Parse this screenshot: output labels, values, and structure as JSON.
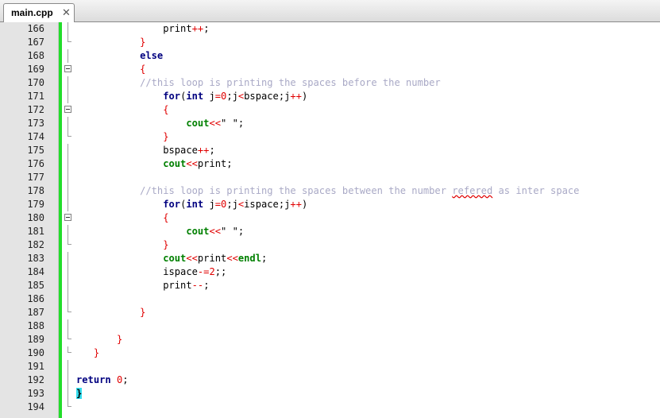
{
  "tab": {
    "title": "main.cpp",
    "close_glyph": "✕"
  },
  "lines": [
    {
      "n": "166",
      "fold": "line",
      "indent": 15,
      "tokens": [
        [
          "id",
          "print"
        ],
        [
          "op",
          "++"
        ],
        [
          "id",
          ";"
        ]
      ]
    },
    {
      "n": "167",
      "fold": "end",
      "indent": 11,
      "tokens": [
        [
          "brace",
          "}"
        ]
      ]
    },
    {
      "n": "168",
      "fold": "line",
      "indent": 11,
      "tokens": [
        [
          "kw",
          "else"
        ]
      ]
    },
    {
      "n": "169",
      "fold": "box",
      "indent": 11,
      "tokens": [
        [
          "brace",
          "{"
        ]
      ]
    },
    {
      "n": "170",
      "fold": "line",
      "indent": 11,
      "tokens": [
        [
          "cmt",
          "//this loop is printing the spaces before the number"
        ]
      ]
    },
    {
      "n": "171",
      "fold": "line",
      "indent": 15,
      "tokens": [
        [
          "kw",
          "for"
        ],
        [
          "id",
          "("
        ],
        [
          "kw",
          "int"
        ],
        [
          "id",
          " j"
        ],
        [
          "op",
          "="
        ],
        [
          "num",
          "0"
        ],
        [
          "id",
          ";j"
        ],
        [
          "op",
          "<"
        ],
        [
          "id",
          "bspace;j"
        ],
        [
          "op",
          "++"
        ],
        [
          "id",
          ")"
        ]
      ]
    },
    {
      "n": "172",
      "fold": "box",
      "indent": 15,
      "tokens": [
        [
          "brace",
          "{"
        ]
      ]
    },
    {
      "n": "173",
      "fold": "line",
      "indent": 19,
      "tokens": [
        [
          "lib",
          "cout"
        ],
        [
          "op",
          "<<"
        ],
        [
          "str",
          "\" \""
        ],
        [
          "id",
          ";"
        ]
      ]
    },
    {
      "n": "174",
      "fold": "end",
      "indent": 15,
      "tokens": [
        [
          "brace",
          "}"
        ]
      ]
    },
    {
      "n": "175",
      "fold": "line",
      "indent": 15,
      "tokens": [
        [
          "id",
          "bspace"
        ],
        [
          "op",
          "++"
        ],
        [
          "id",
          ";"
        ]
      ]
    },
    {
      "n": "176",
      "fold": "line",
      "indent": 15,
      "tokens": [
        [
          "lib",
          "cout"
        ],
        [
          "op",
          "<<"
        ],
        [
          "id",
          "print;"
        ]
      ]
    },
    {
      "n": "177",
      "fold": "line",
      "indent": 0,
      "tokens": []
    },
    {
      "n": "178",
      "fold": "line",
      "indent": 11,
      "tokens": [
        [
          "cmt",
          "//this loop is printing the spaces between the number "
        ],
        [
          "cmt squig",
          "refered"
        ],
        [
          "cmt",
          " as inter space"
        ]
      ]
    },
    {
      "n": "179",
      "fold": "line",
      "indent": 15,
      "tokens": [
        [
          "kw",
          "for"
        ],
        [
          "id",
          "("
        ],
        [
          "kw",
          "int"
        ],
        [
          "id",
          " j"
        ],
        [
          "op",
          "="
        ],
        [
          "num",
          "0"
        ],
        [
          "id",
          ";j"
        ],
        [
          "op",
          "<"
        ],
        [
          "id",
          "ispace;j"
        ],
        [
          "op",
          "++"
        ],
        [
          "id",
          ")"
        ]
      ]
    },
    {
      "n": "180",
      "fold": "box",
      "indent": 15,
      "tokens": [
        [
          "brace",
          "{"
        ]
      ]
    },
    {
      "n": "181",
      "fold": "line",
      "indent": 19,
      "tokens": [
        [
          "lib",
          "cout"
        ],
        [
          "op",
          "<<"
        ],
        [
          "str",
          "\" \""
        ],
        [
          "id",
          ";"
        ]
      ]
    },
    {
      "n": "182",
      "fold": "end",
      "indent": 15,
      "tokens": [
        [
          "brace",
          "}"
        ]
      ]
    },
    {
      "n": "183",
      "fold": "line",
      "indent": 15,
      "tokens": [
        [
          "lib",
          "cout"
        ],
        [
          "op",
          "<<"
        ],
        [
          "id",
          "print"
        ],
        [
          "op",
          "<<"
        ],
        [
          "lib",
          "endl"
        ],
        [
          "id",
          ";"
        ]
      ]
    },
    {
      "n": "184",
      "fold": "line",
      "indent": 15,
      "tokens": [
        [
          "id",
          "ispace"
        ],
        [
          "op",
          "-="
        ],
        [
          "num",
          "2"
        ],
        [
          "id",
          ";;"
        ]
      ]
    },
    {
      "n": "185",
      "fold": "line",
      "indent": 15,
      "tokens": [
        [
          "id",
          "print"
        ],
        [
          "op",
          "--"
        ],
        [
          "id",
          ";"
        ]
      ]
    },
    {
      "n": "186",
      "fold": "line",
      "indent": 0,
      "tokens": []
    },
    {
      "n": "187",
      "fold": "end",
      "indent": 11,
      "tokens": [
        [
          "brace",
          "}"
        ]
      ]
    },
    {
      "n": "188",
      "fold": "line",
      "indent": 0,
      "tokens": []
    },
    {
      "n": "189",
      "fold": "end",
      "indent": 7,
      "tokens": [
        [
          "brace",
          "}"
        ]
      ]
    },
    {
      "n": "190",
      "fold": "end",
      "indent": 3,
      "tokens": [
        [
          "brace",
          "}"
        ]
      ]
    },
    {
      "n": "191",
      "fold": "line",
      "indent": 0,
      "tokens": []
    },
    {
      "n": "192",
      "fold": "line",
      "indent": 0,
      "tokens": [
        [
          "kw",
          "return"
        ],
        [
          "id",
          " "
        ],
        [
          "num",
          "0"
        ],
        [
          "id",
          ";"
        ]
      ]
    },
    {
      "n": "193",
      "fold": "line",
      "indent": 0,
      "tokens": [
        [
          "brace-hl",
          "}"
        ]
      ]
    },
    {
      "n": "194",
      "fold": "end",
      "indent": 0,
      "tokens": []
    }
  ],
  "colors": {
    "keyword": "#000080",
    "operator": "#e00000",
    "library": "#008000",
    "comment": "#a9a9c6",
    "change_bar": "#22dd2a",
    "brace_highlight": "#33ddee"
  }
}
